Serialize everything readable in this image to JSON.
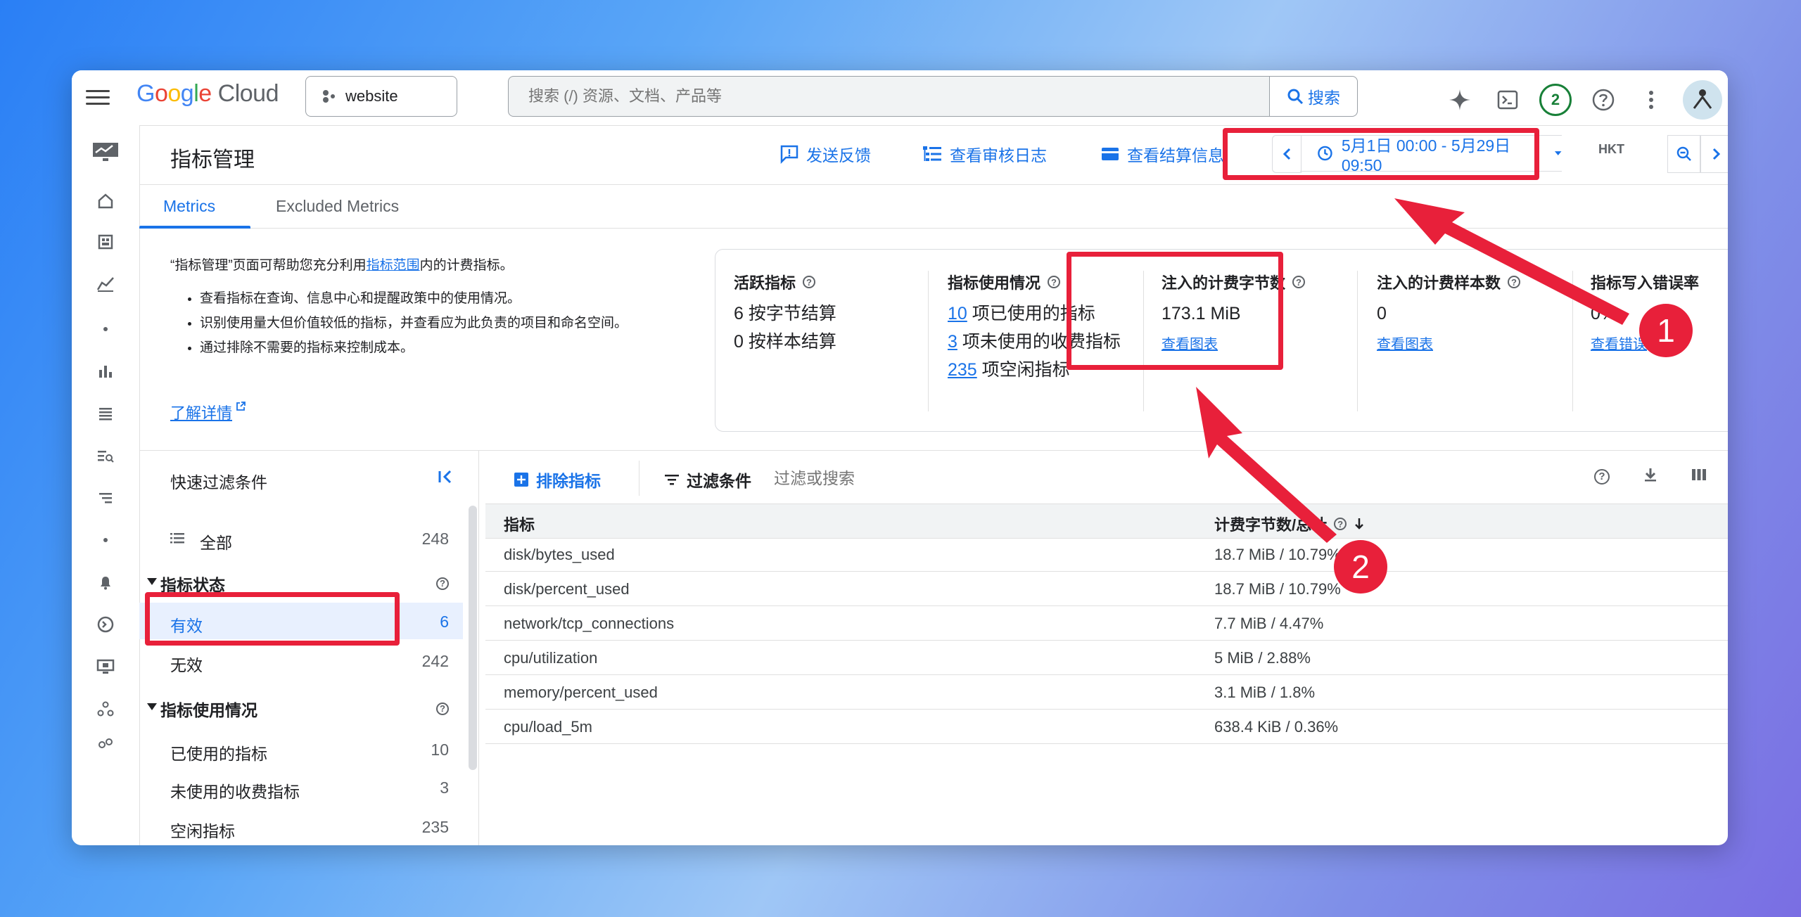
{
  "topbar": {
    "logo_parts": [
      "G",
      "o",
      "o",
      "g",
      "l",
      "e"
    ],
    "logo_suffix": " Cloud",
    "project": "website",
    "search_placeholder": "搜索 (/) 资源、文档、产品等",
    "search_button": "搜索",
    "notification_count": "2"
  },
  "header": {
    "title": "指标管理",
    "feedback": "发送反馈",
    "audit_log": "查看审核日志",
    "billing": "查看结算信息",
    "time_range": "5月1日 00:00 - 5月29日 09:50",
    "timezone": "HKT"
  },
  "tabs": [
    {
      "label": "Metrics"
    },
    {
      "label": "Excluded Metrics"
    }
  ],
  "intro": {
    "text_before": "“指标管理”页面可帮助您充分利用",
    "link": "指标范围",
    "text_after": "内的计费指标。",
    "bullets": [
      "查看指标在查询、信息中心和提醒政策中的使用情况。",
      "识别使用量大但价值较低的指标，并查看应为此负责的项目和命名空间。",
      "通过排除不需要的指标来控制成本。"
    ],
    "learn_more": "了解详情"
  },
  "summary": {
    "active": {
      "title": "活跃指标",
      "line1": "6 按字节结算",
      "line2": "0 按样本结算"
    },
    "usage": {
      "title": "指标使用情况",
      "used_num": "10",
      "used_text": " 项已使用的指标",
      "unused_num": "3",
      "unused_text": " 项未使用的收费指标",
      "idle_num": "235",
      "idle_text": " 项空闲指标"
    },
    "bytes": {
      "title": "注入的计费字节数",
      "value": "173.1 MiB",
      "link": "查看图表"
    },
    "samples": {
      "title": "注入的计费样本数",
      "value": "0",
      "link": "查看图表"
    },
    "errors": {
      "title": "指标写入错误率",
      "value": "0%",
      "link": "查看错误"
    }
  },
  "filters": {
    "title": "快速过滤条件",
    "all": {
      "label": "全部",
      "count": "248"
    },
    "status_section": "指标状态",
    "valid": {
      "label": "有效",
      "count": "6"
    },
    "invalid": {
      "label": "无效",
      "count": "242"
    },
    "usage_section": "指标使用情况",
    "used": {
      "label": "已使用的指标",
      "count": "10"
    },
    "unused": {
      "label": "未使用的收费指标",
      "count": "3"
    },
    "idle": {
      "label": "空闲指标",
      "count": "235"
    }
  },
  "toolbar": {
    "exclude": "排除指标",
    "filter": "过滤条件",
    "filter_placeholder": "过滤或搜索"
  },
  "table": {
    "col_metric": "指标",
    "col_bytes": "计费字节数/总计",
    "rows": [
      {
        "metric": "disk/bytes_used",
        "bytes": "18.7 MiB / 10.79%"
      },
      {
        "metric": "disk/percent_used",
        "bytes": "18.7 MiB / 10.79%"
      },
      {
        "metric": "network/tcp_connections",
        "bytes": "7.7 MiB / 4.47%"
      },
      {
        "metric": "cpu/utilization",
        "bytes": "5 MiB / 2.88%"
      },
      {
        "metric": "memory/percent_used",
        "bytes": "3.1 MiB / 1.8%"
      },
      {
        "metric": "cpu/load_5m",
        "bytes": "638.4 KiB / 0.36%"
      }
    ]
  },
  "annotations": {
    "marker1": "1",
    "marker2": "2"
  },
  "colors": {
    "accent": "#1a73e8",
    "annotation": "#e8203a"
  }
}
